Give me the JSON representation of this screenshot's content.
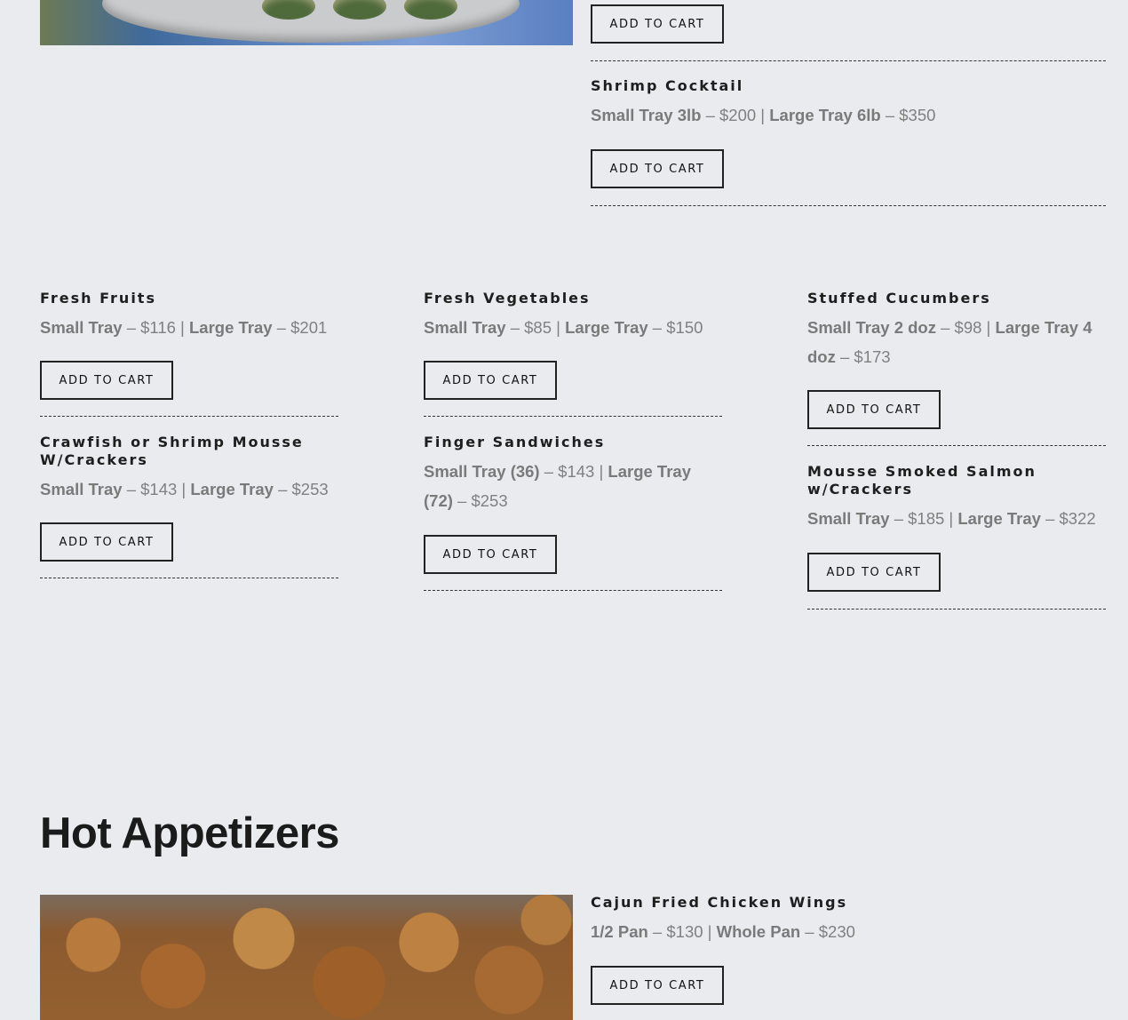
{
  "buttons": {
    "add_to_cart": "ADD TO CART"
  },
  "top_item": {
    "name": "Shrimp Cocktail",
    "small": "Small Tray 3lb",
    "small_price": " – $200 | ",
    "large": "Large Tray 6lb",
    "large_price": " – $350"
  },
  "cold_items": [
    {
      "name": "Fresh Fruits",
      "small": "Small Tray",
      "small_price": " – $116 | ",
      "large": "Large Tray",
      "large_price": " – $201"
    },
    {
      "name": "Fresh Vegetables",
      "small": "Small Tray",
      "small_price": " – $85 | ",
      "large": "Large Tray",
      "large_price": " – $150"
    },
    {
      "name": "Stuffed Cucumbers",
      "small": "Small Tray 2 doz",
      "small_price": " – $98 | ",
      "large": "Large Tray 4 doz",
      "large_price": " – $173"
    },
    {
      "name": "Crawfish or Shrimp Mousse W/Crackers",
      "small": "Small Tray",
      "small_price": " – $143 | ",
      "large": "Large Tray",
      "large_price": " – $253"
    },
    {
      "name": "Finger Sandwiches",
      "small": "Small Tray (36)",
      "small_price": " – $143 | ",
      "large": "Large Tray (72)",
      "large_price": " – $253"
    },
    {
      "name": "Mousse Smoked Salmon w/Crackers",
      "small": "Small Tray",
      "small_price": " – $185 | ",
      "large": "Large Tray",
      "large_price": " – $322"
    }
  ],
  "hot_section": {
    "title": "Hot Appetizers",
    "item": {
      "name": "Cajun Fried Chicken Wings",
      "small": "1/2 Pan",
      "small_price": " – $130 | ",
      "large": "Whole Pan",
      "large_price": " – $230"
    }
  }
}
